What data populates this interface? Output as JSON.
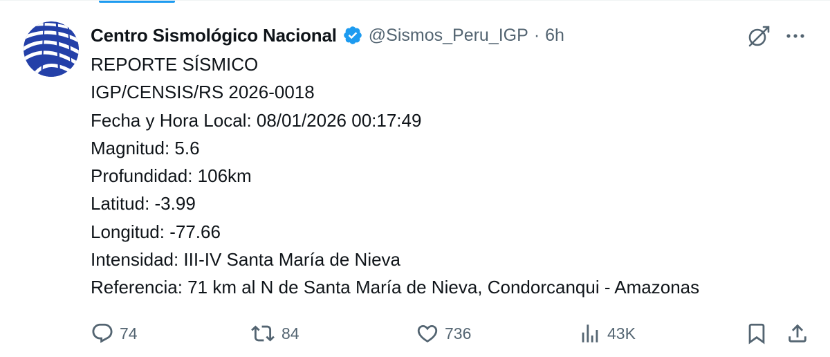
{
  "tweet": {
    "author_name": "Centro Sismológico Nacional",
    "handle": "@Sismos_Peru_IGP",
    "separator": "·",
    "time": "6h",
    "lines": [
      "REPORTE SÍSMICO",
      "IGP/CENSIS/RS 2026-0018",
      "Fecha y Hora Local: 08/01/2026 00:17:49",
      "Magnitud: 5.6",
      "Profundidad: 106km",
      "Latitud: -3.99",
      "Longitud: -77.66",
      "Intensidad: III-IV Santa María de Nieva",
      "Referencia: 71 km al N de Santa María de Nieva, Condorcanqui - Amazonas"
    ]
  },
  "actions": {
    "replies": "74",
    "reposts": "84",
    "likes": "736",
    "views": "43K"
  },
  "icons": {
    "avatar": "igp-logo",
    "verified": "verified-badge-icon",
    "grok": "grok-icon",
    "more": "more-icon",
    "reply": "reply-icon",
    "repost": "repost-icon",
    "like": "heart-icon",
    "views": "views-chart-icon",
    "bookmark": "bookmark-icon",
    "share": "share-icon"
  },
  "colors": {
    "text": "#0f1419",
    "secondary": "#536471",
    "accent": "#1d9bf0",
    "logo_blue": "#1f3f9f"
  }
}
